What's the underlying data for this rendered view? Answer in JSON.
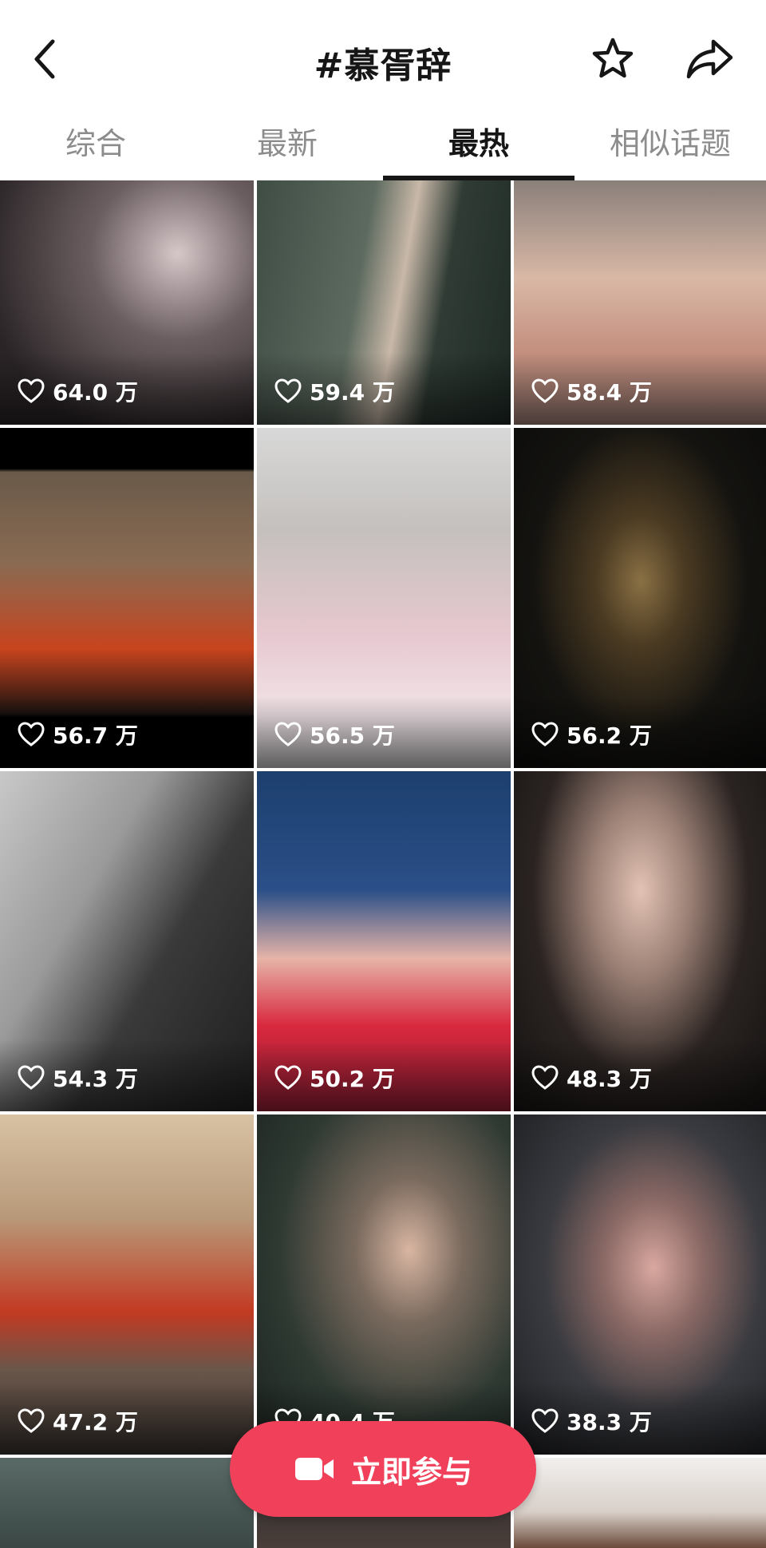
{
  "header": {
    "title": "#慕胥辞"
  },
  "tabs": [
    {
      "label": "综合",
      "active": false
    },
    {
      "label": "最新",
      "active": false
    },
    {
      "label": "最热",
      "active": true
    },
    {
      "label": "相似话题",
      "active": false
    }
  ],
  "videos": [
    {
      "likes": "64.0 万",
      "theme": "#3a3436"
    },
    {
      "likes": "59.4 万",
      "theme": "#3d4a43"
    },
    {
      "likes": "58.4 万",
      "theme": "#b89a8e"
    },
    {
      "likes": "56.7 万",
      "theme": "#2a2220"
    },
    {
      "likes": "56.5 万",
      "theme": "#c9c6c4"
    },
    {
      "likes": "56.2 万",
      "theme": "#1b1a17"
    },
    {
      "likes": "54.3 万",
      "theme": "#6e6e6e"
    },
    {
      "likes": "50.2 万",
      "theme": "#24365e"
    },
    {
      "likes": "48.3 万",
      "theme": "#2b2624"
    },
    {
      "likes": "47.2 万",
      "theme": "#9d8a78"
    },
    {
      "likes": "40.4 万",
      "theme": "#303833"
    },
    {
      "likes": "38.3 万",
      "theme": "#2d2f33"
    }
  ],
  "join_button": {
    "label": "立即参与"
  },
  "colors": {
    "accent": "#f0405a",
    "active_tab": "#161616",
    "inactive_tab": "#8c8c8c"
  }
}
